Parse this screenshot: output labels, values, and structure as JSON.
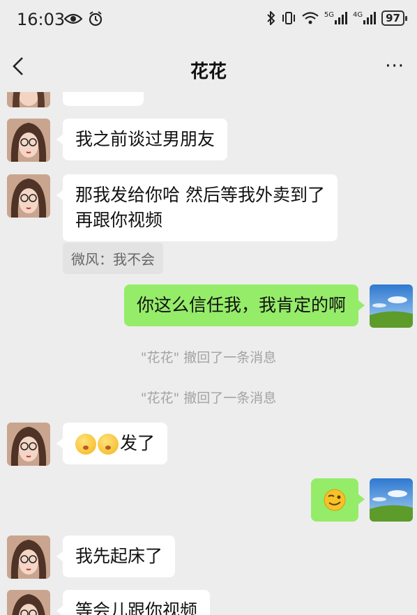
{
  "status_bar": {
    "time": "16:03",
    "battery": "97",
    "signal_1": "5G",
    "signal_2": "4G"
  },
  "header": {
    "title": "花花",
    "more": "···"
  },
  "messages": [
    {
      "from": "them",
      "text": "我之前谈过男朋友"
    },
    {
      "from": "them",
      "line1": "那我发给你哈 然后等我外卖到了",
      "line2": "再跟你视频"
    },
    {
      "from": "quote",
      "text": "微风：我不会"
    },
    {
      "from": "me",
      "text": "你这么信任我，我肯定的啊"
    },
    {
      "from": "system",
      "text": "\"花花\" 撤回了一条消息"
    },
    {
      "from": "system",
      "text": "\"花花\" 撤回了一条消息"
    },
    {
      "from": "them",
      "text": "发了"
    },
    {
      "from": "me",
      "text": ""
    },
    {
      "from": "them",
      "text": "我先起床了"
    },
    {
      "from": "them",
      "text": "等会儿跟你视频"
    }
  ],
  "colors": {
    "background": "#ededed",
    "bubble_in": "#ffffff",
    "bubble_out": "#95ec69",
    "system_text": "#a3a3a3"
  }
}
